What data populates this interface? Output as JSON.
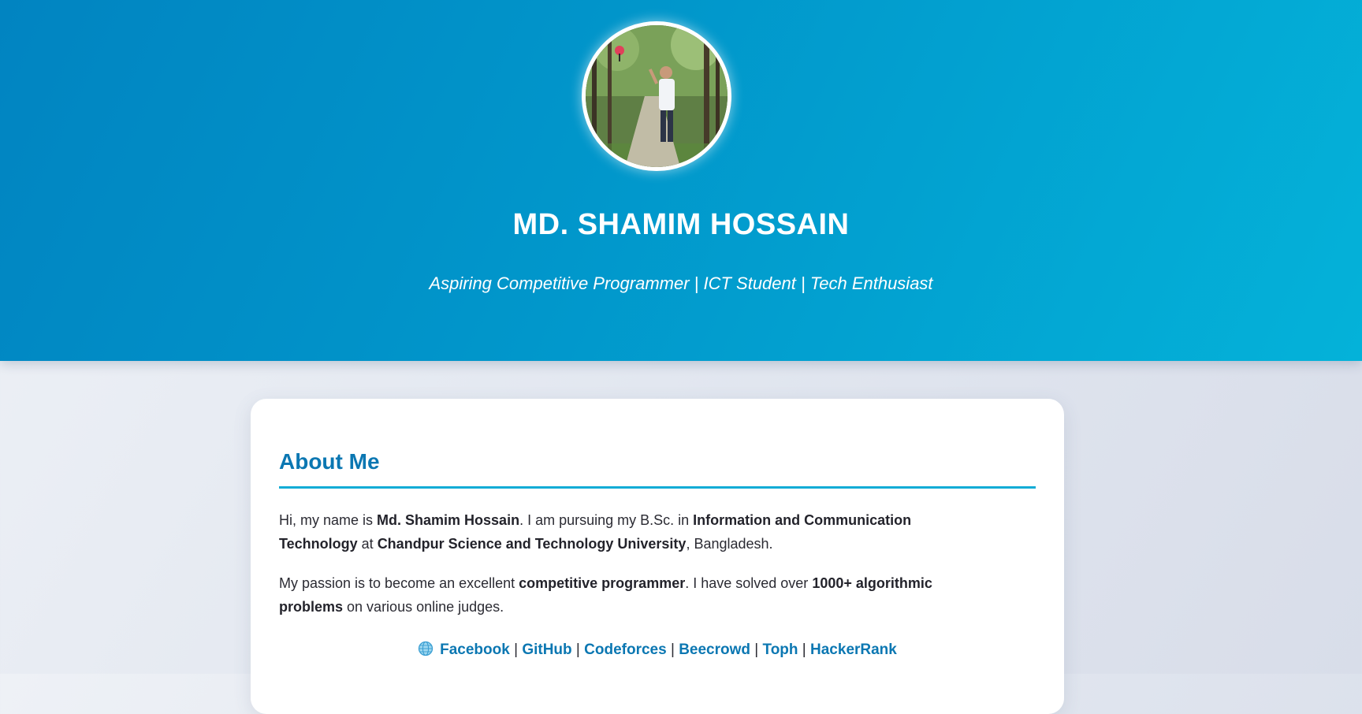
{
  "header": {
    "name": "MD. SHAMIM HOSSAIN",
    "tagline": "Aspiring Competitive Programmer | ICT Student | Tech Enthusiast",
    "avatar_icon": "profile-photo"
  },
  "about": {
    "title": "About Me",
    "p1": {
      "t1": "Hi, my name is ",
      "b1": "Md. Shamim Hossain",
      "t2": ". I am pursuing my B.Sc. in ",
      "b2": "Information and Communication Technology",
      "t3": " at ",
      "b3": "Chandpur Science and Technology University",
      "t4": ", Bangladesh."
    },
    "p2": {
      "t1": "My passion is to become an excellent ",
      "b1": "competitive programmer",
      "t2": ". I have solved over ",
      "b2": "1000+ algorithmic problems",
      "t3": " on various online judges."
    }
  },
  "links": {
    "icon": "globe-icon",
    "separator": " | ",
    "items": [
      {
        "label": "Facebook"
      },
      {
        "label": "GitHub"
      },
      {
        "label": "Codeforces"
      },
      {
        "label": "Beecrowd"
      },
      {
        "label": "Toph"
      },
      {
        "label": "HackerRank"
      }
    ]
  },
  "colors": {
    "hero_start": "#0184c1",
    "hero_end": "#04b2d9",
    "accent": "#0b77b2",
    "rule": "#12acd6"
  }
}
